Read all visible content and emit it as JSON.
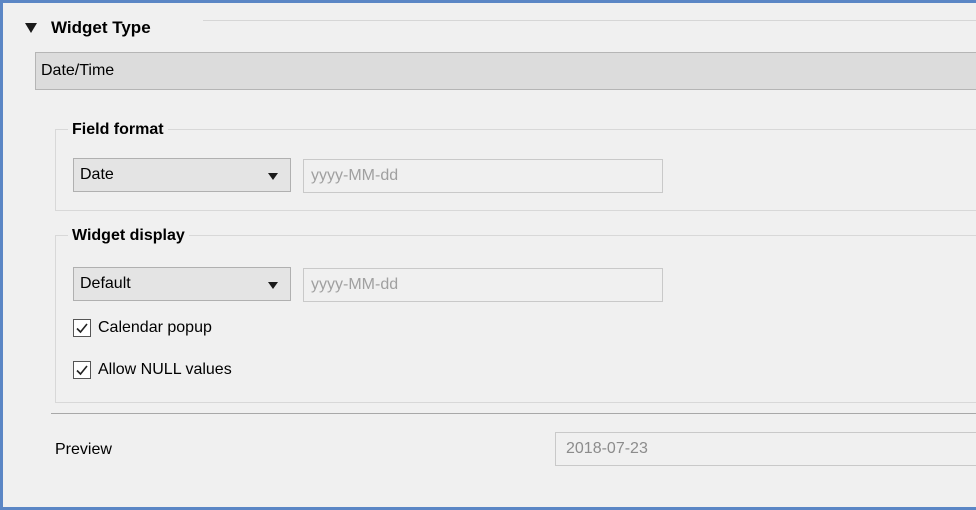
{
  "widget_type": {
    "header_title": "Widget Type",
    "selected": "Date/Time"
  },
  "field_format": {
    "title": "Field format",
    "combo_value": "Date",
    "format_text": "yyyy-MM-dd"
  },
  "widget_display": {
    "title": "Widget display",
    "combo_value": "Default",
    "format_text": "yyyy-MM-dd",
    "calendar_popup": {
      "label": "Calendar popup",
      "checked": true
    },
    "allow_null": {
      "label": "Allow NULL values",
      "checked": true
    }
  },
  "preview": {
    "label": "Preview",
    "value": "2018-07-23"
  }
}
